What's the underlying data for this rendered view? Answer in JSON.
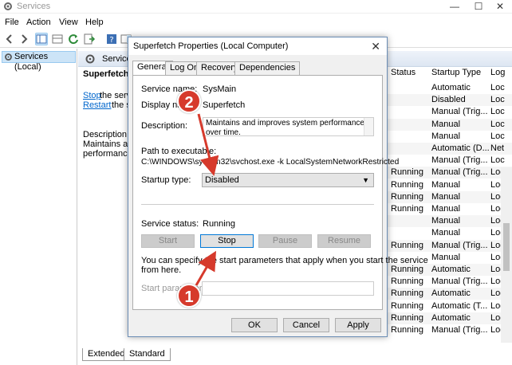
{
  "window": {
    "title": "Services",
    "close": "✕",
    "maximize": "☐",
    "minimize": "—"
  },
  "menu": [
    "File",
    "Action",
    "View",
    "Help"
  ],
  "tree": {
    "root": "Services (Local)"
  },
  "content_header": "Services (Local)",
  "desc_pane": {
    "service_name": "Superfetch",
    "stop_link": "Stop",
    "stop_rest": "the servi",
    "restart_link": "Restart",
    "restart_rest": "the se",
    "description_label": "Description:",
    "desc_line1": "Maintains and",
    "desc_line2": "performance"
  },
  "columns": {
    "status": "Status",
    "startup_type": "Startup Type",
    "log": "Log"
  },
  "rows": [
    {
      "status": "",
      "startup": "Automatic",
      "log": "Loc"
    },
    {
      "status": "",
      "startup": "Disabled",
      "log": "Loc"
    },
    {
      "status": "",
      "startup": "Manual (Trig...",
      "log": "Loc"
    },
    {
      "status": "",
      "startup": "Manual",
      "log": "Loc"
    },
    {
      "status": "",
      "startup": "Manual",
      "log": "Loc"
    },
    {
      "status": "",
      "startup": "Automatic (D...",
      "log": "Net"
    },
    {
      "status": "",
      "startup": "Manual (Trig...",
      "log": "Loc"
    },
    {
      "status": "Running",
      "startup": "Manual (Trig...",
      "log": "Loc"
    },
    {
      "status": "Running",
      "startup": "Manual",
      "log": "Loc"
    },
    {
      "status": "Running",
      "startup": "Manual",
      "log": "Loc"
    },
    {
      "status": "Running",
      "startup": "Manual",
      "log": "Loc"
    },
    {
      "status": "",
      "startup": "Manual",
      "log": "Loc"
    },
    {
      "status": "",
      "startup": "Manual",
      "log": "Loc"
    },
    {
      "status": "Running",
      "startup": "Manual (Trig...",
      "log": "Loc"
    },
    {
      "status": "",
      "startup": "Manual",
      "log": "Loc"
    },
    {
      "status": "Running",
      "startup": "Automatic",
      "log": "Loc"
    },
    {
      "status": "Running",
      "startup": "Manual (Trig...",
      "log": "Loc"
    },
    {
      "status": "Running",
      "startup": "Automatic",
      "log": "Loc"
    },
    {
      "status": "Running",
      "startup": "Automatic (T...",
      "log": "Loc"
    },
    {
      "status": "Running",
      "startup": "Automatic",
      "log": "Loc"
    },
    {
      "status": "Running",
      "startup": "Manual (Trig...",
      "log": "Loc"
    }
  ],
  "bottom_tabs": {
    "extended": "Extended",
    "standard": "Standard"
  },
  "dialog": {
    "title": "Superfetch Properties (Local Computer)",
    "close": "✕",
    "tabs": [
      "General",
      "Log On",
      "Recovery",
      "Dependencies"
    ],
    "service_name_label": "Service name:",
    "service_name_value": "SysMain",
    "display_name_label": "Display name:",
    "display_name_value": "Superfetch",
    "description_label": "Description:",
    "description_value": "Maintains and improves system performance over time.",
    "path_label": "Path to executable:",
    "path_value": "C:\\WINDOWS\\system32\\svchost.exe -k LocalSystemNetworkRestricted",
    "startup_type_label": "Startup type:",
    "startup_type_value": "Disabled",
    "service_status_label": "Service status:",
    "service_status_value": "Running",
    "start_button": "Start",
    "stop_button": "Stop",
    "pause_button": "Pause",
    "resume_button": "Resume",
    "hint_line1": "You can specify the start parameters that apply when you start the service",
    "hint_line2": "from here.",
    "start_params_label": "Start parameters:",
    "ok_button": "OK",
    "cancel_button": "Cancel",
    "apply_button": "Apply"
  },
  "annotations": {
    "marker_1": "1",
    "marker_2": "2",
    "color": "#d63a2c"
  }
}
